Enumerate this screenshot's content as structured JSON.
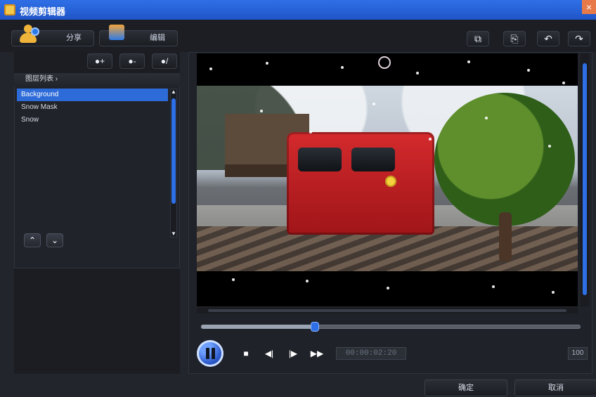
{
  "window": {
    "title": "视频剪辑器",
    "close_glyph": "×"
  },
  "tabs": [
    {
      "label": "分享"
    },
    {
      "label": "编辑"
    }
  ],
  "toolbar_right": {
    "buttons": [
      {
        "icon": "copy-icon",
        "glyph": "⧉"
      },
      {
        "icon": "paste-icon",
        "glyph": "⎘"
      },
      {
        "icon": "undo-icon",
        "glyph": "↶"
      },
      {
        "icon": "redo-icon",
        "glyph": "↷"
      }
    ]
  },
  "left_tools": [
    {
      "icon": "add-layer-icon",
      "glyph": "●+"
    },
    {
      "icon": "remove-layer-icon",
      "glyph": "●-"
    },
    {
      "icon": "edit-layer-icon",
      "glyph": "●/"
    }
  ],
  "layers": {
    "header": "图层列表 ›",
    "items": [
      {
        "label": "Background",
        "selected": true
      },
      {
        "label": "Snow Mask",
        "selected": false
      },
      {
        "label": "Snow",
        "selected": false
      }
    ]
  },
  "layer_move": [
    {
      "icon": "chevron-up-icon",
      "glyph": "⌃"
    },
    {
      "icon": "chevron-down-icon",
      "glyph": "⌄"
    }
  ],
  "player": {
    "progress_fraction": 0.3,
    "timecode": "00:00:02:20",
    "speed": "100",
    "controls": {
      "stop": "■",
      "prev_frame": "◀|",
      "next_frame": "|▶",
      "fast_forward": "▶▶"
    }
  },
  "footer": {
    "ok": "确定",
    "cancel": "取消"
  },
  "colors": {
    "accent_blue": "#2f6fe6"
  }
}
